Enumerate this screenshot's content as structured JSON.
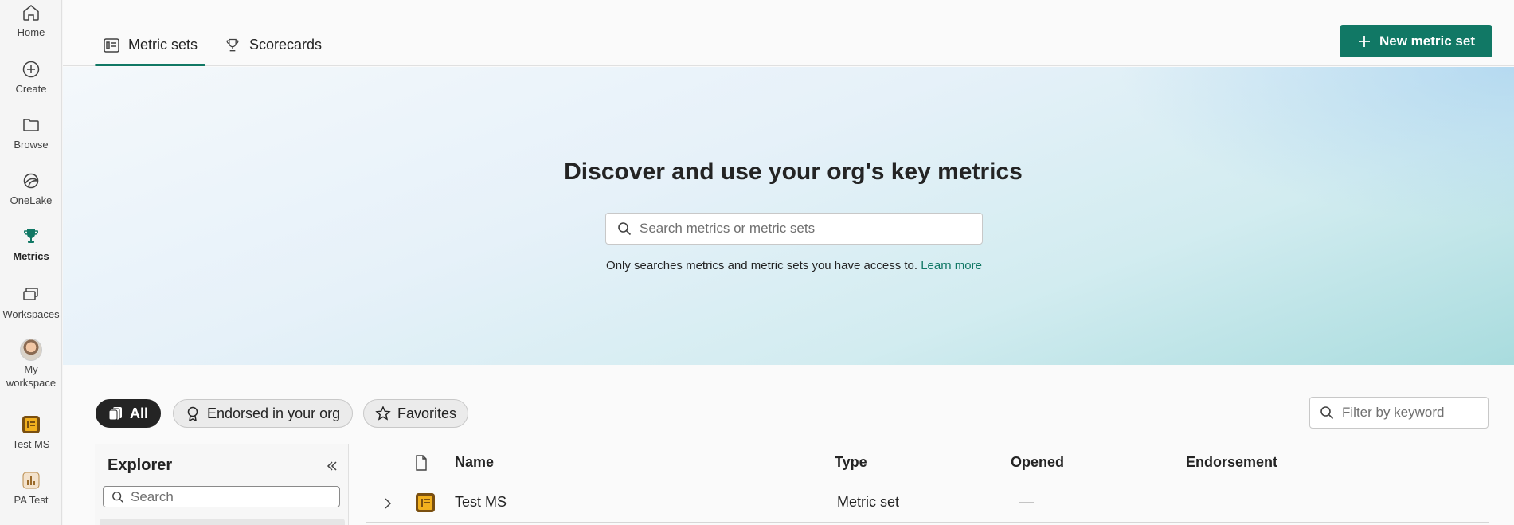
{
  "rail": {
    "items": [
      {
        "label": "Home",
        "icon": "home-icon"
      },
      {
        "label": "Create",
        "icon": "plus-circle-icon"
      },
      {
        "label": "Browse",
        "icon": "folder-icon"
      },
      {
        "label": "OneLake",
        "icon": "onelake-icon"
      },
      {
        "label": "Metrics",
        "icon": "trophy-icon",
        "active": true
      },
      {
        "label": "Workspaces",
        "icon": "workspaces-icon"
      },
      {
        "label": "My workspace",
        "icon": "avatar"
      },
      {
        "label": "Test MS",
        "icon": "metric-set-icon"
      },
      {
        "label": "PA Test",
        "icon": "report-icon"
      }
    ]
  },
  "tabs": [
    {
      "label": "Metric sets",
      "icon": "metric-set-tab-icon",
      "active": true
    },
    {
      "label": "Scorecards",
      "icon": "trophy-outline-icon",
      "active": false
    }
  ],
  "new_button": {
    "label": "New metric set"
  },
  "hero": {
    "title": "Discover and use your org's key metrics",
    "search_placeholder": "Search metrics or metric sets",
    "note": "Only searches metrics and metric sets you have access to.",
    "learn_more": "Learn more"
  },
  "filters": {
    "chips": [
      {
        "label": "All",
        "active": true
      },
      {
        "label": "Endorsed in your org",
        "active": false
      },
      {
        "label": "Favorites",
        "active": false
      }
    ],
    "keyword_placeholder": "Filter by keyword"
  },
  "explorer": {
    "title": "Explorer",
    "search_placeholder": "Search"
  },
  "table": {
    "headers": {
      "name": "Name",
      "type": "Type",
      "opened": "Opened",
      "endorsement": "Endorsement"
    },
    "rows": [
      {
        "name": "Test MS",
        "type": "Metric set",
        "opened": "—",
        "endorsement": ""
      }
    ]
  },
  "colors": {
    "accent": "#117865",
    "rail_bg": "#f5f5f5",
    "chip_active": "#242424"
  }
}
